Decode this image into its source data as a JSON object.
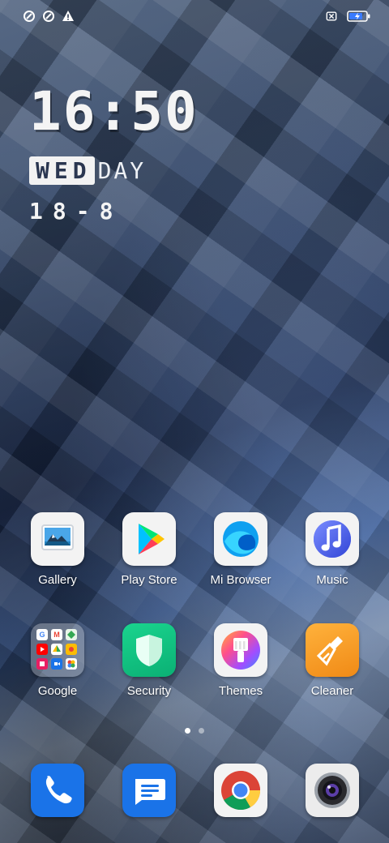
{
  "clock": {
    "time": "16:50",
    "weekday_box": "WED",
    "weekday_suffix": "DAY",
    "date": "18-8"
  },
  "apps_row1": [
    {
      "label": "Gallery",
      "icon": "gallery-icon"
    },
    {
      "label": "Play Store",
      "icon": "play-store-icon"
    },
    {
      "label": "Mi Browser",
      "icon": "mi-browser-icon"
    },
    {
      "label": "Music",
      "icon": "music-icon"
    }
  ],
  "apps_row2": [
    {
      "label": "Google",
      "icon": "google-folder-icon"
    },
    {
      "label": "Security",
      "icon": "security-shield-icon"
    },
    {
      "label": "Themes",
      "icon": "themes-brush-icon"
    },
    {
      "label": "Cleaner",
      "icon": "cleaner-brush-icon"
    }
  ],
  "dock": [
    {
      "icon": "phone-icon"
    },
    {
      "icon": "messages-icon"
    },
    {
      "icon": "chrome-icon"
    },
    {
      "icon": "camera-icon"
    }
  ],
  "pager": {
    "pages": 2,
    "current": 1
  },
  "status": {
    "left_icons": [
      "data-saver-icon",
      "data-saver-icon",
      "warning-icon"
    ],
    "right_icons": [
      "no-sim-icon",
      "battery-charging-icon"
    ]
  }
}
